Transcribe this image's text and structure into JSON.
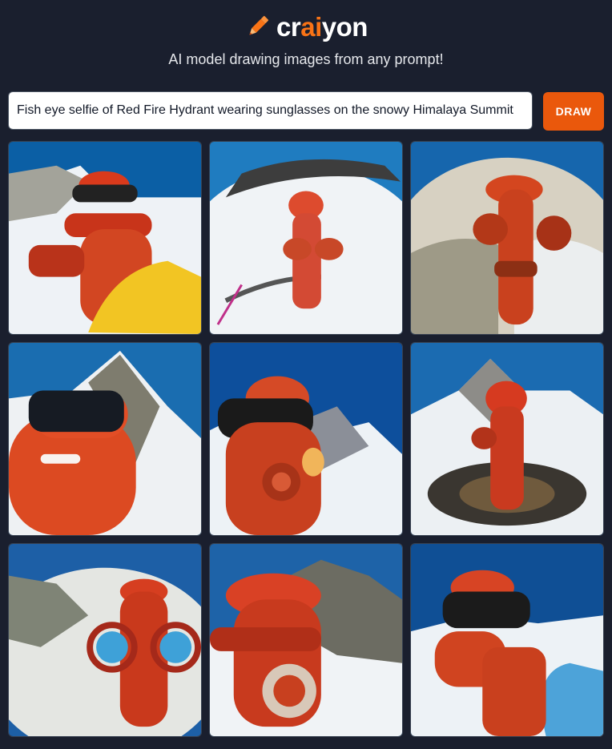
{
  "app": {
    "logo_text_pre": "cr",
    "logo_text_accent": "ai",
    "logo_text_post": "yon",
    "logo_icon": "pencil-icon",
    "tagline": "AI model drawing images from any prompt!"
  },
  "prompt": {
    "value": "Fish eye selfie of Red Fire Hydrant wearing sunglasses on the snowy Himalaya Summit"
  },
  "toolbar": {
    "draw_label": "DRAW"
  },
  "colors": {
    "background": "#1a1f2e",
    "accent": "#ea580c",
    "brand_orange": "#f97316"
  },
  "images": [
    {
      "index": 1,
      "subject": "red fire hydrant with sunglasses, yellow pipe, snowy peak"
    },
    {
      "index": 2,
      "subject": "red fire hydrant on snowy summit, fish eye view"
    },
    {
      "index": 3,
      "subject": "red fire hydrant on rocky snowy summit"
    },
    {
      "index": 4,
      "subject": "red hydrant face with sunglasses near mountain peak"
    },
    {
      "index": 5,
      "subject": "red hydrant with sunglasses, snowy ridge"
    },
    {
      "index": 6,
      "subject": "red hydrant on mountain summit with peak behind"
    },
    {
      "index": 7,
      "subject": "red hydrant with goggle frames, cloudy summit"
    },
    {
      "index": 8,
      "subject": "red hydrant with swirled face, mountain behind"
    },
    {
      "index": 9,
      "subject": "red hydrant with sunglasses, blue fabric, clouds"
    }
  ]
}
